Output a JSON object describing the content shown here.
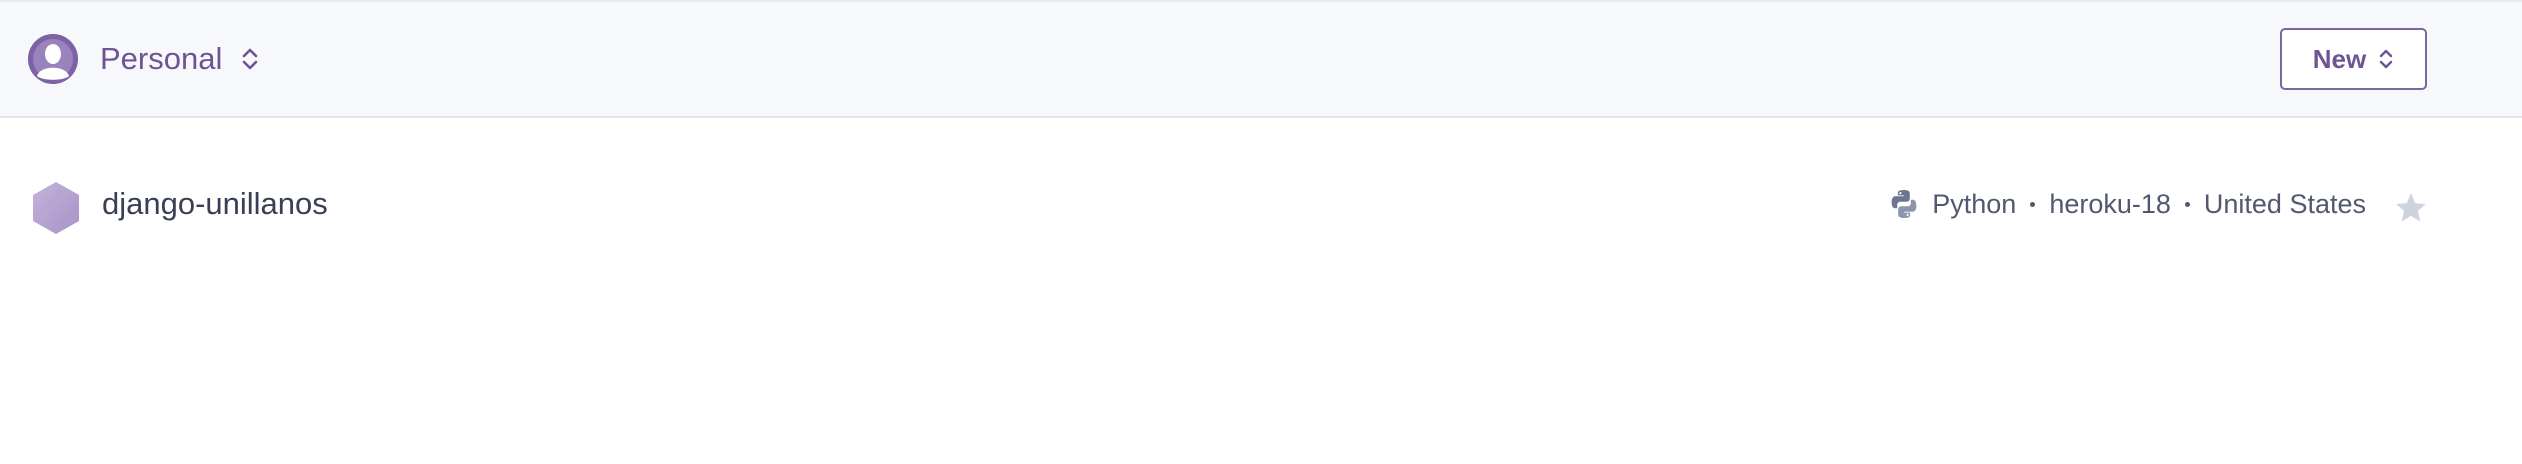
{
  "header": {
    "account_label": "Personal",
    "new_button_label": "New"
  },
  "apps": [
    {
      "name": "django-unillanos",
      "language": "Python",
      "stack": "heroku-18",
      "region": "United States",
      "starred": false
    }
  ],
  "colors": {
    "brand_purple": "#6f5495",
    "avatar_purple": "#7e62a6",
    "hex_lavender": "#b9a8d1",
    "text_dark": "#3a3f55",
    "meta_gray": "#525870",
    "star_gray": "#cfd3e0",
    "topbar_bg": "#f7f8fb"
  },
  "icons": {
    "avatar": "user-avatar-icon",
    "switcher": "chevron-up-down-icon",
    "app": "hexagon-app-icon",
    "language": "python-icon",
    "favorite": "star-icon"
  }
}
